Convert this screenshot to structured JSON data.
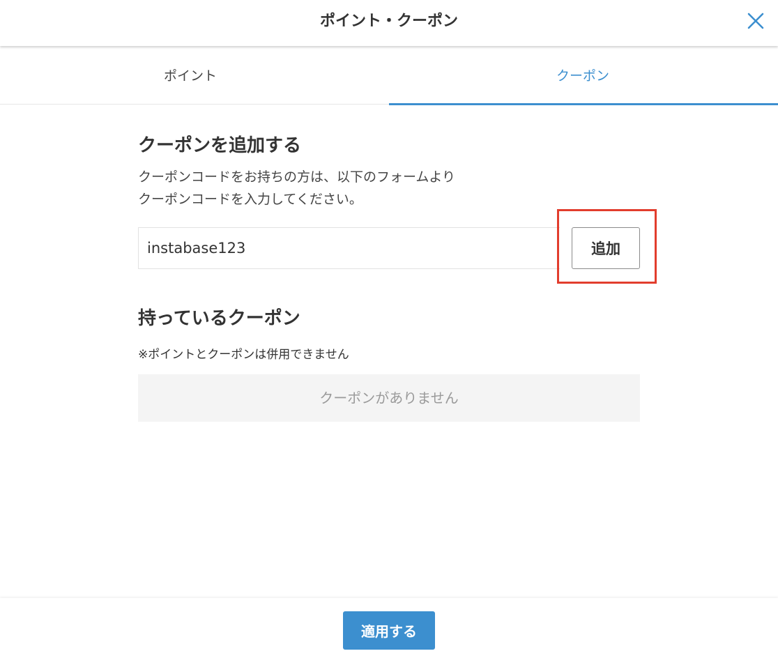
{
  "header": {
    "title": "ポイント・クーポン",
    "close_icon": "close-icon"
  },
  "tabs": [
    {
      "label": "ポイント",
      "active": false
    },
    {
      "label": "クーポン",
      "active": true
    }
  ],
  "add_coupon": {
    "title": "クーポンを追加する",
    "description_line1": "クーポンコードをお持ちの方は、以下のフォームより",
    "description_line2": "クーポンコードを入力してください。",
    "input_value": "instabase123",
    "add_button_label": "追加"
  },
  "my_coupons": {
    "title": "持っているクーポン",
    "note": "※ポイントとクーポンは併用できません",
    "empty_text": "クーポンがありません"
  },
  "footer": {
    "apply_button_label": "適用する"
  },
  "colors": {
    "accent": "#3c8fcf",
    "highlight": "#e23d2d"
  }
}
